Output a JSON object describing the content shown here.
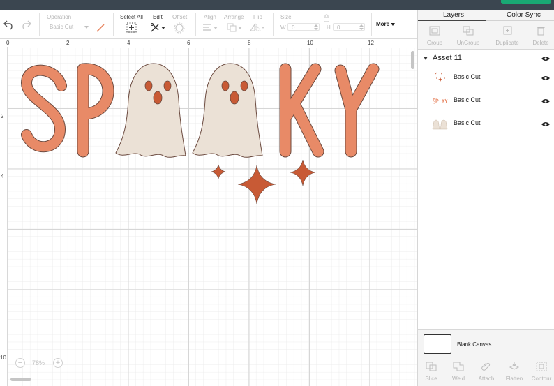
{
  "colors": {
    "letter_fill": "#e88a67",
    "ghost_fill": "#ebe1d6",
    "ghost_face": "#c85a35",
    "star_fill": "#c85a35",
    "outline": "#6b4a3f",
    "grid_minor": "#ececec",
    "grid_major": "#d6d6d6"
  },
  "toolbar": {
    "operation_label": "Operation",
    "operation_value": "Basic Cut",
    "select_all_label": "Select All",
    "edit_label": "Edit",
    "offset_label": "Offset",
    "align_label": "Align",
    "arrange_label": "Arrange",
    "flip_label": "Flip",
    "size_label": "Size",
    "width_prefix": "W",
    "width_value": "0",
    "height_prefix": "H",
    "height_value": "0",
    "more_label": "More"
  },
  "rulers": {
    "top": [
      "0",
      "2",
      "4",
      "6",
      "8",
      "10",
      "12"
    ],
    "left": [
      "2",
      "4",
      "10"
    ]
  },
  "zoom": {
    "value": "78%",
    "minus": "−",
    "plus": "+"
  },
  "panel": {
    "tabs": [
      "Layers",
      "Color Sync"
    ],
    "actions": [
      "Group",
      "UnGroup",
      "Duplicate",
      "Delete"
    ],
    "asset_title": "Asset 11",
    "layers": [
      {
        "label": "Basic Cut",
        "thumb": "stars"
      },
      {
        "label": "Basic Cut",
        "thumb": "letters"
      },
      {
        "label": "Basic Cut",
        "thumb": "ghosts"
      }
    ],
    "blank_canvas_label": "Blank Canvas",
    "bottom_actions": [
      "Slice",
      "Weld",
      "Attach",
      "Flatten",
      "Contour"
    ]
  }
}
